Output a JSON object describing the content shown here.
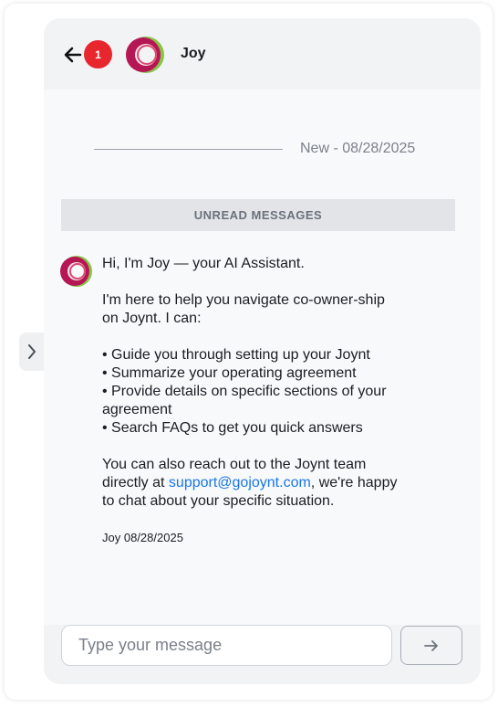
{
  "header": {
    "back_label": "back",
    "unread_count": "1",
    "contact_name": "Joy"
  },
  "conversation": {
    "date_label": "New - 08/28/2025",
    "unread_banner": "UNREAD MESSAGES",
    "message": {
      "greeting": "Hi, I'm Joy — your AI Assistant.",
      "intro": "I'm here to help you navigate co-owner-ship on Joynt. I can:",
      "bullets": [
        "• Guide you through setting up your Joynt",
        "• Summarize your operating agreement",
        "• Provide details on specific sections of your agreement",
        "• Search FAQs to get you quick answers"
      ],
      "closing_before_link": "You can also reach out to the Joynt team directly at ",
      "support_email": "support@gojoynt.com",
      "closing_after_link": ", we're happy to chat about your specific situation.",
      "sender": "Joy",
      "timestamp": "08/28/2025"
    }
  },
  "composer": {
    "placeholder": "Type your message",
    "value": ""
  },
  "icons": {
    "back": "arrow-left-icon",
    "send": "arrow-right-icon",
    "expand": "chevron-right-icon",
    "avatar": "ring-logo-icon"
  },
  "colors": {
    "badge": "#e8262e",
    "link": "#1976e8",
    "panel": "#f2f3f5",
    "body": "#f8f9fb",
    "avatar_outer": "#c2185b",
    "avatar_inner": "#8bc34a"
  }
}
